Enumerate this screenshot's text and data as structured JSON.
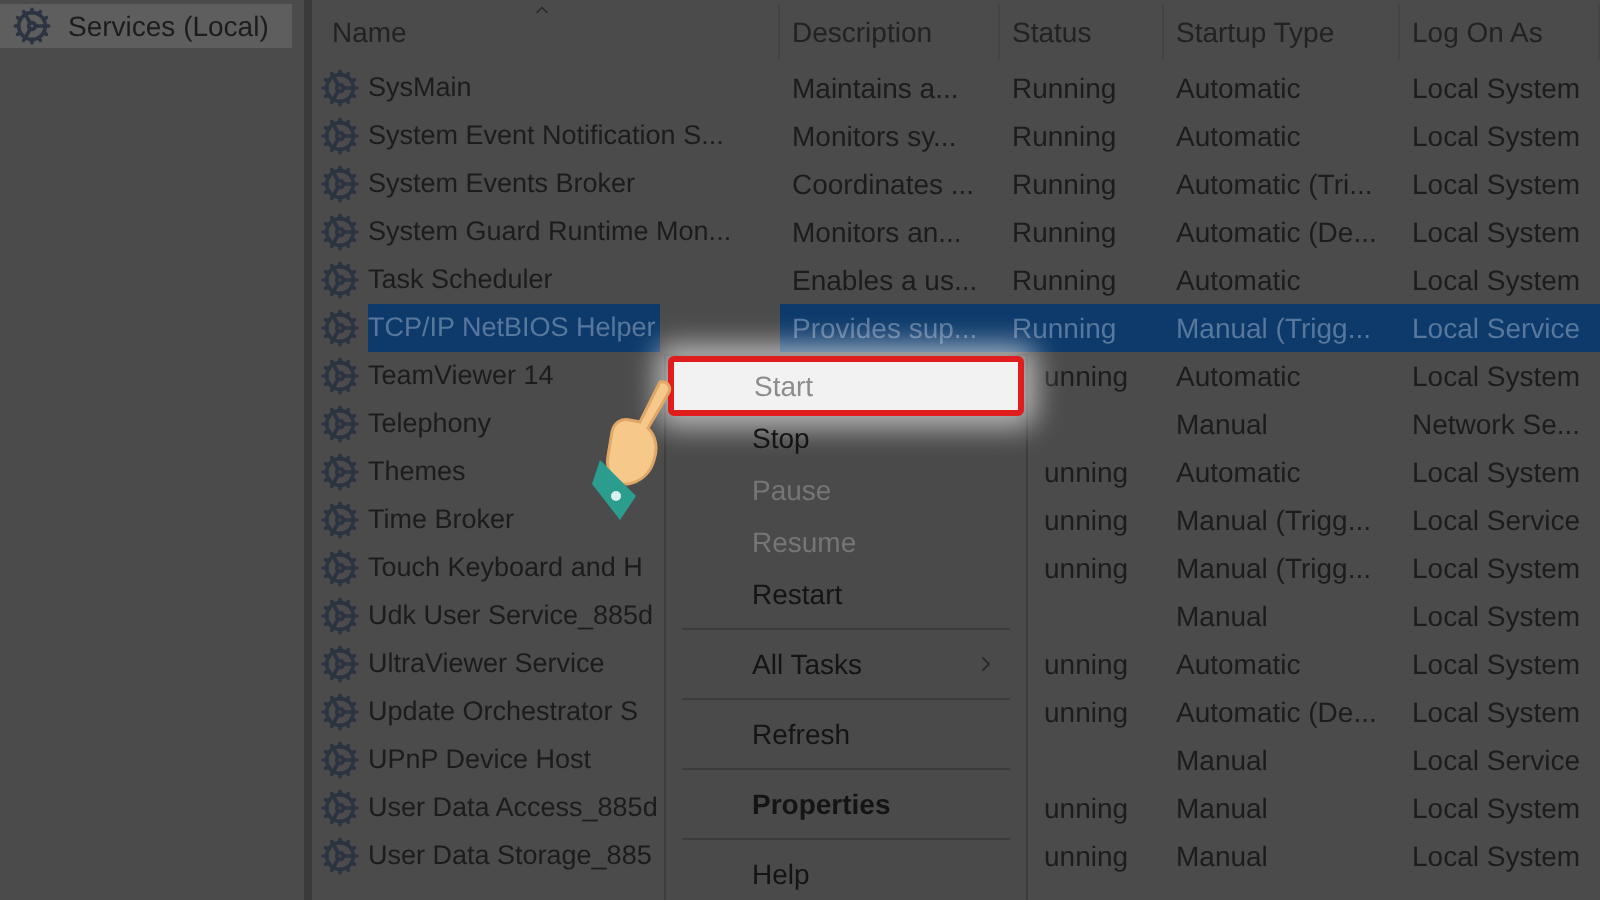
{
  "sidebar": {
    "items": [
      {
        "label": "Services (Local)",
        "selected": true
      }
    ]
  },
  "table": {
    "columns": [
      "Name",
      "Description",
      "Status",
      "Startup Type",
      "Log On As"
    ],
    "rows": [
      {
        "name": "SysMain",
        "description": "Maintains a...",
        "status": "Running",
        "startup_type": "Automatic",
        "log_on_as": "Local System",
        "selected": false
      },
      {
        "name": "System Event Notification S...",
        "description": "Monitors sy...",
        "status": "Running",
        "startup_type": "Automatic",
        "log_on_as": "Local System",
        "selected": false
      },
      {
        "name": "System Events Broker",
        "description": "Coordinates ...",
        "status": "Running",
        "startup_type": "Automatic (Tri...",
        "log_on_as": "Local System",
        "selected": false
      },
      {
        "name": "System Guard Runtime Mon...",
        "description": "Monitors an...",
        "status": "Running",
        "startup_type": "Automatic (De...",
        "log_on_as": "Local System",
        "selected": false
      },
      {
        "name": "Task Scheduler",
        "description": "Enables a us...",
        "status": "Running",
        "startup_type": "Automatic",
        "log_on_as": "Local System",
        "selected": false
      },
      {
        "name": "TCP/IP NetBIOS Helper",
        "description": "Provides sup...",
        "status": "Running",
        "startup_type": "Manual (Trigg...",
        "log_on_as": "Local Service",
        "selected": true
      },
      {
        "name": "TeamViewer 14",
        "status": "unning",
        "startup_type": "Automatic",
        "log_on_as": "Local System",
        "selected": false
      },
      {
        "name": "Telephony",
        "startup_type": "Manual",
        "log_on_as": "Network Se...",
        "selected": false
      },
      {
        "name": "Themes",
        "status": "unning",
        "startup_type": "Automatic",
        "log_on_as": "Local System",
        "selected": false
      },
      {
        "name": "Time Broker",
        "status": "unning",
        "startup_type": "Manual (Trigg...",
        "log_on_as": "Local Service",
        "selected": false
      },
      {
        "name": "Touch Keyboard and H",
        "status": "unning",
        "startup_type": "Manual (Trigg...",
        "log_on_as": "Local System",
        "selected": false
      },
      {
        "name": "Udk User Service_885d",
        "startup_type": "Manual",
        "log_on_as": "Local System",
        "selected": false
      },
      {
        "name": "UltraViewer Service",
        "status": "unning",
        "startup_type": "Automatic",
        "log_on_as": "Local System",
        "selected": false
      },
      {
        "name": "Update Orchestrator S",
        "status": "unning",
        "startup_type": "Automatic (De...",
        "log_on_as": "Local System",
        "selected": false
      },
      {
        "name": "UPnP Device Host",
        "startup_type": "Manual",
        "log_on_as": "Local Service",
        "selected": false
      },
      {
        "name": "User Data Access_885d",
        "status": "unning",
        "startup_type": "Manual",
        "log_on_as": "Local System",
        "selected": false
      },
      {
        "name": "User Data Storage_885",
        "status": "unning",
        "startup_type": "Manual",
        "log_on_as": "Local System",
        "selected": false
      }
    ]
  },
  "context_menu": {
    "items": [
      {
        "kind": "item",
        "label": "Start",
        "disabled": true,
        "highlighted": true
      },
      {
        "kind": "item",
        "label": "Stop",
        "disabled": false,
        "highlighted": false
      },
      {
        "kind": "item",
        "label": "Pause",
        "disabled": true,
        "highlighted": false
      },
      {
        "kind": "item",
        "label": "Resume",
        "disabled": true,
        "highlighted": false
      },
      {
        "kind": "item",
        "label": "Restart",
        "disabled": false,
        "highlighted": false
      },
      {
        "kind": "separator"
      },
      {
        "kind": "submenu",
        "label": "All Tasks",
        "disabled": false,
        "highlighted": false
      },
      {
        "kind": "separator"
      },
      {
        "kind": "item",
        "label": "Refresh",
        "disabled": false,
        "highlighted": false
      },
      {
        "kind": "separator"
      },
      {
        "kind": "default",
        "label": "Properties",
        "disabled": false,
        "highlighted": false
      },
      {
        "kind": "separator"
      },
      {
        "kind": "item",
        "label": "Help",
        "disabled": false,
        "highlighted": false
      }
    ]
  }
}
